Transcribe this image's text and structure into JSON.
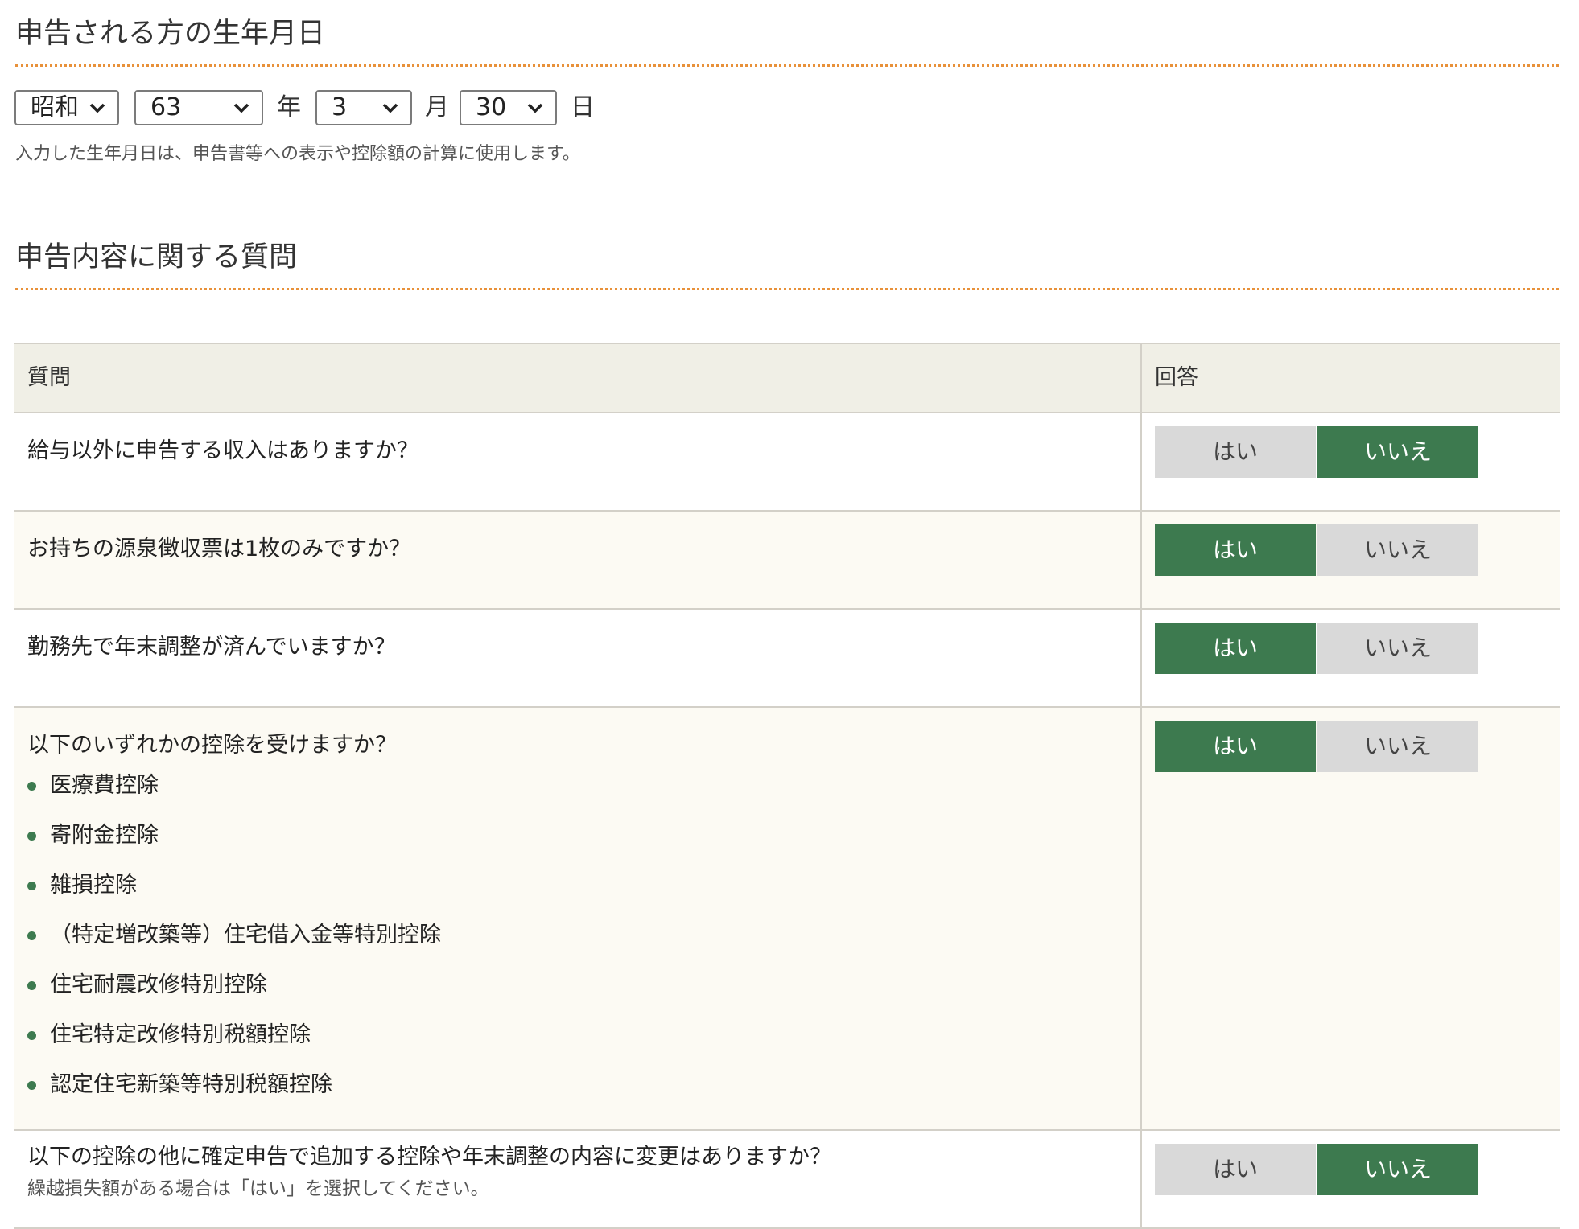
{
  "birth_section": {
    "title": "申告される方の生年月日",
    "era": "昭和",
    "year": "63",
    "year_unit": "年",
    "month": "3",
    "month_unit": "月",
    "day": "30",
    "day_unit": "日",
    "note": "入力した生年月日は、申告書等への表示や控除額の計算に使用します。"
  },
  "question_section": {
    "title": "申告内容に関する質問",
    "col_question": "質問",
    "col_answer": "回答",
    "yes_label": "はい",
    "no_label": "いいえ",
    "questions": [
      {
        "text": "給与以外に申告する収入はありますか？",
        "selected": "いいえ"
      },
      {
        "text": "お持ちの源泉徴収票は1枚のみですか？",
        "selected": "はい"
      },
      {
        "text": "勤務先で年末調整が済んでいますか？",
        "selected": "はい"
      },
      {
        "text": "以下のいずれかの控除を受けますか？",
        "selected": "はい",
        "items": [
          "医療費控除",
          "寄附金控除",
          "雑損控除",
          "（特定増改築等）住宅借入金等特別控除",
          "住宅耐震改修特別控除",
          "住宅特定改修特別税額控除",
          "認定住宅新築等特別税額控除"
        ]
      },
      {
        "text": "以下の控除の他に確定申告で追加する控除や年末調整の内容に変更はありますか？",
        "note": "繰越損失額がある場合は「はい」を選択してください。",
        "selected": "いいえ"
      }
    ]
  },
  "colors": {
    "accent_green": "#3d7a4f",
    "divider_orange": "#e8913a",
    "header_bg": "#f0efe6"
  }
}
